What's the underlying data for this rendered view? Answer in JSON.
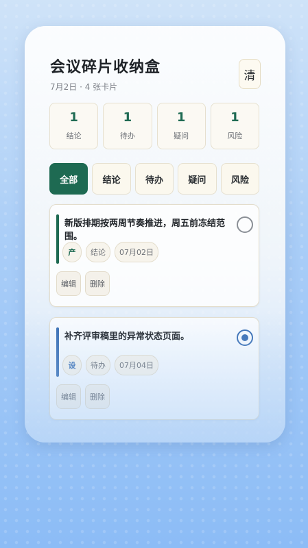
{
  "header": {
    "title": "会议碎片收纳盒",
    "subtitle": "7月2日 · 4 张卡片",
    "clear_label": "清"
  },
  "stats": [
    {
      "count": "1",
      "label": "结论"
    },
    {
      "count": "1",
      "label": "待办"
    },
    {
      "count": "1",
      "label": "疑问"
    },
    {
      "count": "1",
      "label": "风险"
    }
  ],
  "filters": [
    {
      "label": "全部",
      "active": true
    },
    {
      "label": "结论",
      "active": false
    },
    {
      "label": "待办",
      "active": false
    },
    {
      "label": "疑问",
      "active": false
    },
    {
      "label": "风险",
      "active": false
    }
  ],
  "cards": [
    {
      "text": "新版排期按两周节奏推进，周五前冻结范围。",
      "avatar": "产",
      "type": "结论",
      "date": "07月02日",
      "edit": "编辑",
      "delete": "删除",
      "accent": "#1e6a52",
      "avatar_color": "#1e6a52",
      "done": false
    },
    {
      "text": "补齐评审稿里的异常状态页面。",
      "avatar": "设",
      "type": "待办",
      "date": "07月04日",
      "edit": "编辑",
      "delete": "删除",
      "accent": "#3a6fb4",
      "avatar_color": "#3a6fb4",
      "done": true
    }
  ]
}
